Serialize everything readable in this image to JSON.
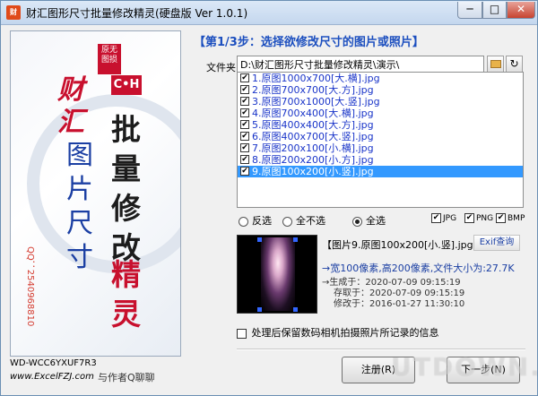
{
  "window": {
    "title": "财汇图形尺寸批量修改精灵(硬盘版 Ver 1.0.1)",
    "min_label": "─",
    "max_label": "□",
    "close_label": "✕"
  },
  "banner": {
    "stamp": "原无图损",
    "logo": "C•H",
    "caihui": "财汇",
    "tupian": "图片尺寸",
    "piliang": "批量修改",
    "jingling": "精灵",
    "qq": "QQ：2540968810"
  },
  "footer": {
    "machine_code": "WD-WCC6YXUF7R3",
    "website": "www.ExcelFZJ.com",
    "chat": "与作者Q聊聊"
  },
  "step": {
    "title": "【第1/3步：选择欲修改尺寸的图片或照片】"
  },
  "folder": {
    "label": "文件夹",
    "value": "D:\\财汇图形尺寸批量修改精灵\\演示\\"
  },
  "files": [
    {
      "name": "1.原图1000x700[大.横].jpg",
      "checked": true,
      "selected": false
    },
    {
      "name": "2.原图700x700[大.方].jpg",
      "checked": true,
      "selected": false
    },
    {
      "name": "3.原图700x1000[大.竖].jpg",
      "checked": true,
      "selected": false
    },
    {
      "name": "4.原图700x400[大.横].jpg",
      "checked": true,
      "selected": false
    },
    {
      "name": "5.原图400x400[大.方].jpg",
      "checked": true,
      "selected": false
    },
    {
      "name": "6.原图400x700[大.竖].jpg",
      "checked": true,
      "selected": false
    },
    {
      "name": "7.原图200x100[小.横].jpg",
      "checked": true,
      "selected": false
    },
    {
      "name": "8.原图200x200[小.方].jpg",
      "checked": true,
      "selected": false
    },
    {
      "name": "9.原图100x200[小.竖].jpg",
      "checked": true,
      "selected": true
    }
  ],
  "selection": {
    "invert": "反选",
    "none": "全不选",
    "all": "全选",
    "active": "all"
  },
  "formats": {
    "jpg": "JPG",
    "png": "PNG",
    "bmp": "BMP"
  },
  "preview": {
    "title": "【图片9.原图100x200[小.竖].jpg】",
    "exif_button": "Exif查询",
    "size_info": "→宽100像素,高200像素,文件大小为:27.7K",
    "created": "→生成于：2020-07-09 09:15:19",
    "saved": "存取于：2020-07-09 09:15:19",
    "modified": "修改于：2016-01-27 11:30:10"
  },
  "options": {
    "keep_exif": "处理后保留数码相机拍摄照片所记录的信息"
  },
  "buttons": {
    "register": "注册(R)",
    "next": "下一步(N)"
  },
  "watermark": "UTDOWN.COM"
}
